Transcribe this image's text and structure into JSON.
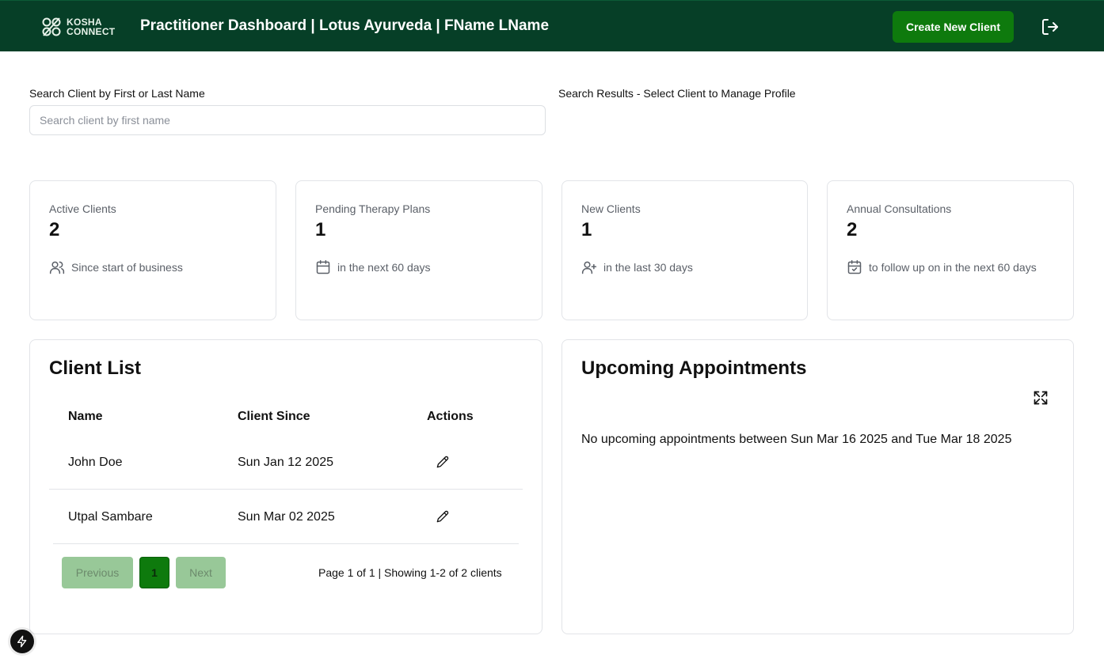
{
  "header": {
    "logo_text": [
      "KOSHA",
      "CONNECT"
    ],
    "title": "Practitioner Dashboard | Lotus Ayurveda | FName LName",
    "create_button": "Create New Client",
    "logout_icon": "logout-icon",
    "bg_color": "#063f27",
    "accent": "#0e7a0d"
  },
  "search": {
    "label": "Search Client by First or Last Name",
    "placeholder": "Search client by first name",
    "value": "",
    "results_label": "Search Results - Select Client to Manage Profile"
  },
  "stats": [
    {
      "label": "Active Clients",
      "value": "2",
      "sub": "Since start of business",
      "icon": "users-icon"
    },
    {
      "label": "Pending Therapy Plans",
      "value": "1",
      "sub": "in the next 60 days",
      "icon": "calendar-icon"
    },
    {
      "label": "New Clients",
      "value": "1",
      "sub": "in the last 30 days",
      "icon": "user-plus-icon"
    },
    {
      "label": "Annual Consultations",
      "value": "2",
      "sub": "to follow up on in the next 60 days",
      "icon": "calendar-check-icon"
    }
  ],
  "client_list": {
    "title": "Client List",
    "columns": [
      "Name",
      "Client Since",
      "Actions"
    ],
    "rows": [
      {
        "name": "John Doe",
        "since": "Sun Jan 12 2025",
        "action_icon": "pencil-icon"
      },
      {
        "name": "Utpal Sambare",
        "since": "Sun Mar 02 2025",
        "action_icon": "pencil-icon"
      }
    ],
    "pagination": {
      "previous": "Previous",
      "page": "1",
      "next": "Next",
      "info": "Page 1 of 1 | Showing 1-2 of 2 clients"
    }
  },
  "appointments": {
    "title": "Upcoming Appointments",
    "expand_icon": "expand-icon",
    "empty_message": "No upcoming appointments between Sun Mar 16 2025 and Tue Mar 18 2025"
  },
  "floating": {
    "icon": "lightning-bolt-icon"
  }
}
